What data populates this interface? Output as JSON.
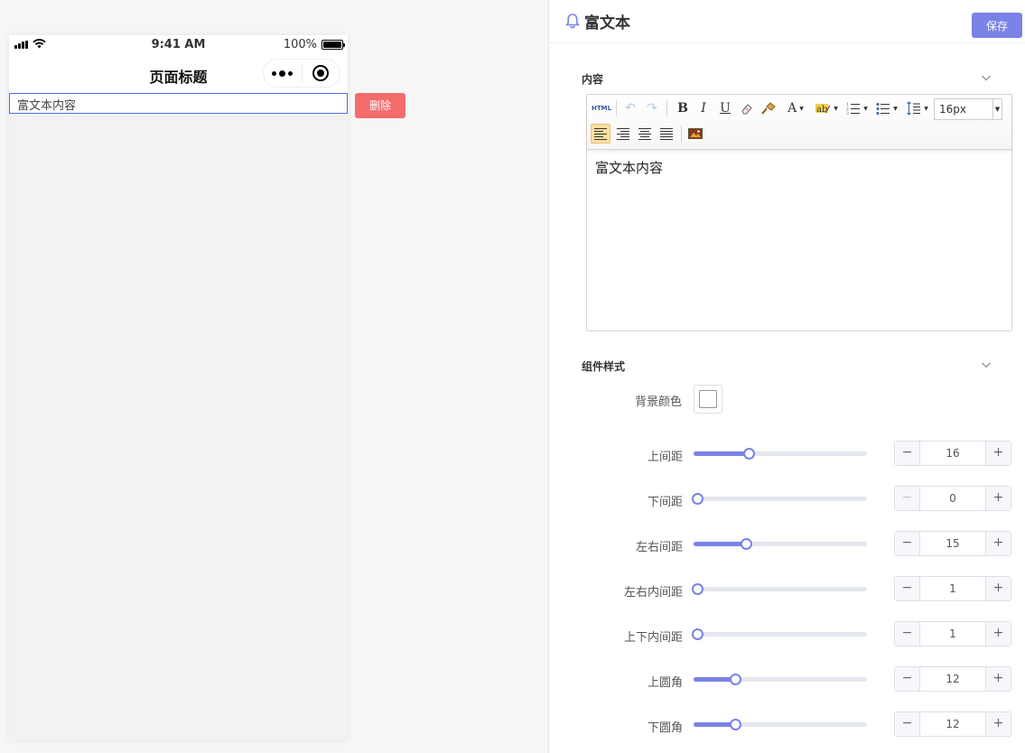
{
  "phone": {
    "status": {
      "time": "9:41 AM",
      "battery": "100%"
    },
    "nav_title": "页面标题",
    "rich_text": "富文本内容",
    "delete_label": "删除"
  },
  "panel": {
    "title": "富文本",
    "save_label": "保存",
    "content_section": "内容",
    "editor": {
      "html_button": "HTML",
      "font_size": "16px",
      "content": "富文本内容"
    },
    "style_section": "组件样式",
    "bg_color_label": "背景颜色",
    "bg_color": "#ffffff",
    "accent_color": "#7a82e6",
    "delete_color": "#f56c6c",
    "sliders": [
      {
        "label": "上间距",
        "value": "16",
        "level": 0.32,
        "min_disabled": false
      },
      {
        "label": "下间距",
        "value": "0",
        "level": 0.0,
        "min_disabled": true
      },
      {
        "label": "左右间距",
        "value": "15",
        "level": 0.3,
        "min_disabled": false
      },
      {
        "label": "左右内间距",
        "value": "1",
        "level": 0.02,
        "min_disabled": false
      },
      {
        "label": "上下内间距",
        "value": "1",
        "level": 0.02,
        "min_disabled": false
      },
      {
        "label": "上圆角",
        "value": "12",
        "level": 0.24,
        "min_disabled": false
      },
      {
        "label": "下圆角",
        "value": "12",
        "level": 0.24,
        "min_disabled": false
      }
    ]
  }
}
